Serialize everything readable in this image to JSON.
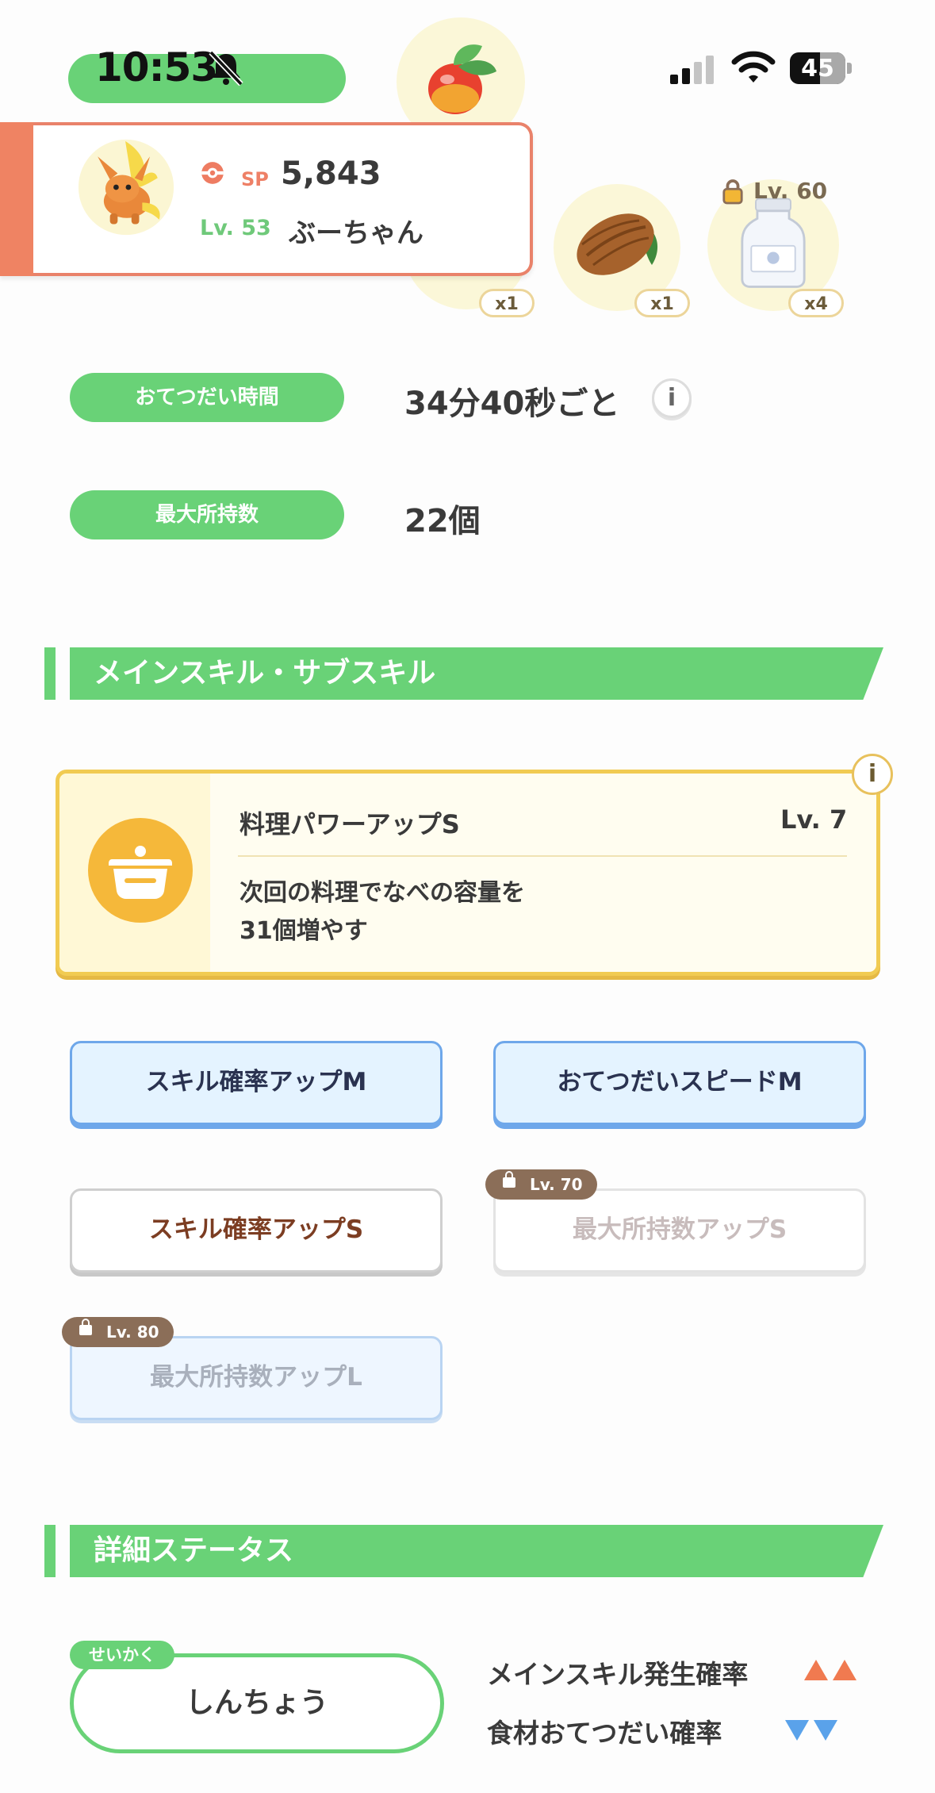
{
  "status_bar": {
    "time": "10:53",
    "battery": "45"
  },
  "pokemon": {
    "sp_label": "SP",
    "sp_value": "5,843",
    "level": "Lv. 53",
    "nickname": "ぶーちゃん"
  },
  "ingredients": [
    {
      "name": "apple",
      "count": "x1"
    },
    {
      "name": "cacao",
      "count": "x1"
    },
    {
      "name": "milk",
      "count": "x4",
      "lock_level": "Lv. 60"
    }
  ],
  "help_time": {
    "label": "おてつだい時間",
    "value": "34分40秒ごと"
  },
  "carry_limit": {
    "label": "最大所持数",
    "value": "22個"
  },
  "skills_section": {
    "title": "メインスキル・サブスキル"
  },
  "main_skill": {
    "name": "料理パワーアップS",
    "level": "Lv. 7",
    "description": "次回の料理でなべの容量を\n31個増やす"
  },
  "sub_skills": [
    {
      "label": "スキル確率アップM",
      "state": "active-gold"
    },
    {
      "label": "おてつだいスピードM",
      "state": "active-gold"
    },
    {
      "label": "スキル確率アップS",
      "state": "active-white"
    },
    {
      "label": "最大所持数アップS",
      "state": "locked",
      "lock_level": "Lv. 70"
    },
    {
      "label": "最大所持数アップL",
      "state": "locked",
      "lock_level": "Lv. 80"
    }
  ],
  "details_section": {
    "title": "詳細ステータス"
  },
  "nature": {
    "tag": "せいかく",
    "name": "しんちょう",
    "effects": [
      {
        "label": "メインスキル発生確率",
        "direction": "up",
        "color": "#f07a50"
      },
      {
        "label": "食材おてつだい確率",
        "direction": "down",
        "color": "#5aa2ea"
      }
    ]
  },
  "colors": {
    "accent_green": "#69d277",
    "card_orange": "#ef8363",
    "skill_gold": "#f1cb52"
  }
}
